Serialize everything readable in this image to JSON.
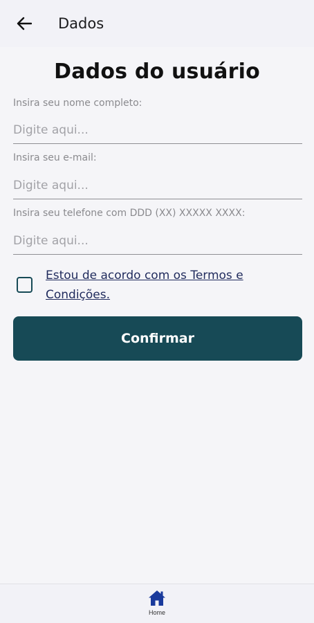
{
  "header": {
    "title": "Dados",
    "back_icon": "arrow-left-icon"
  },
  "page": {
    "title": "Dados do usuário"
  },
  "form": {
    "name": {
      "label": "Insira seu nome completo:",
      "placeholder": "Digite aqui..."
    },
    "email": {
      "label": "Insira seu e-mail:",
      "placeholder": "Digite aqui..."
    },
    "phone": {
      "label": "Insira seu telefone com DDD (XX) XXXXX XXXX:",
      "placeholder": "Digite aqui..."
    },
    "terms": {
      "label": "Estou de acordo com os Termos e Condições.",
      "checked": false
    },
    "confirm_label": "Confirmar"
  },
  "bottom_nav": {
    "items": [
      {
        "label": "Home",
        "icon": "home-icon",
        "color": "#1a3a9c"
      }
    ]
  },
  "colors": {
    "primary": "#174a56",
    "link": "#1f2a5c",
    "nav_active": "#1a3a9c"
  }
}
